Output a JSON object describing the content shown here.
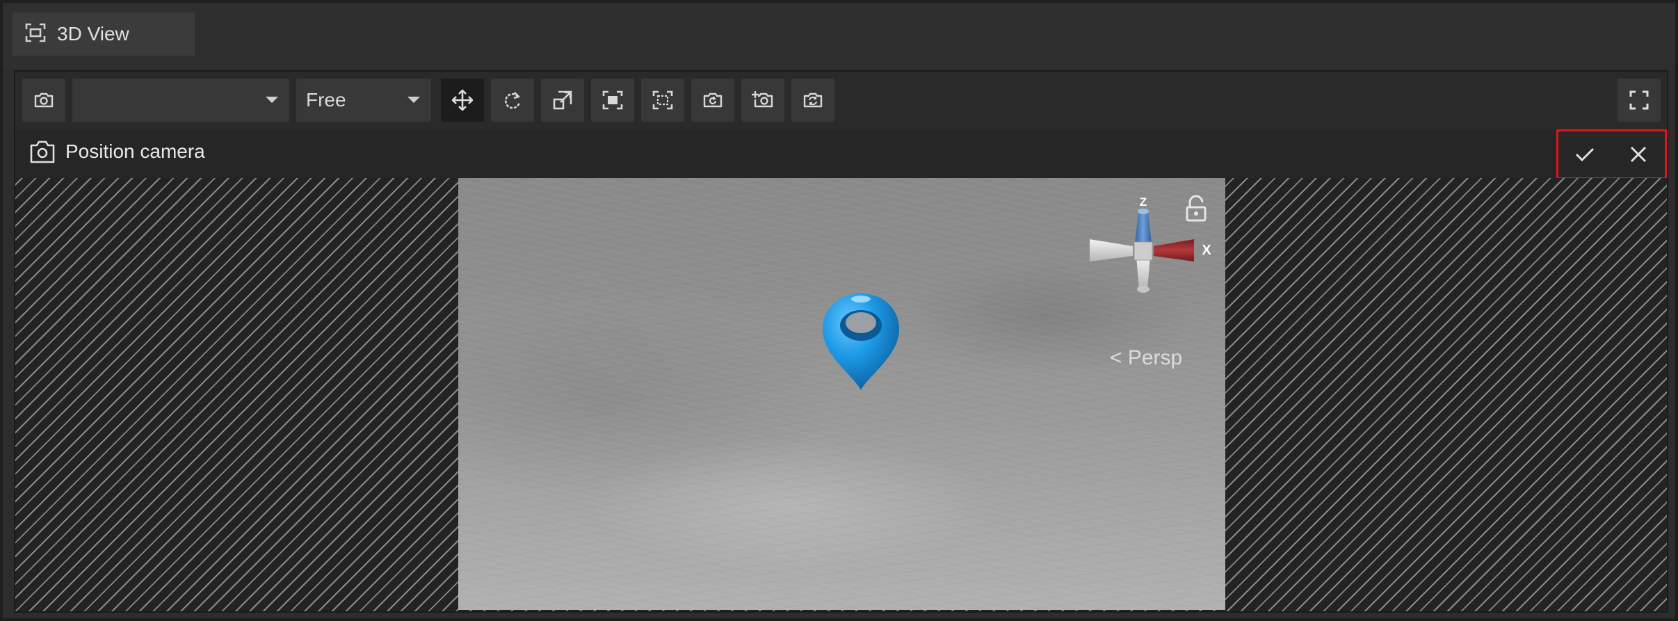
{
  "tab": {
    "title": "3D View",
    "icon": "view-frame-icon"
  },
  "toolbar": {
    "camera_select": {
      "value": "",
      "icon": "chevron-down-icon"
    },
    "navigation_mode": {
      "value": "Free",
      "icon": "chevron-down-icon"
    },
    "tools": [
      {
        "name": "camera-icon"
      },
      {
        "name": "move-icon"
      },
      {
        "name": "rotate-icon"
      },
      {
        "name": "scale-icon"
      },
      {
        "name": "frame-selection-icon"
      },
      {
        "name": "frame-all-icon"
      },
      {
        "name": "reset-camera-icon"
      },
      {
        "name": "add-camera-icon"
      },
      {
        "name": "swap-camera-icon"
      },
      {
        "name": "fullscreen-icon"
      }
    ]
  },
  "mode": {
    "title": "Position camera",
    "icon": "camera-icon",
    "confirm_icon": "check-icon",
    "cancel_icon": "close-icon",
    "highlight_color": "#e0141c"
  },
  "viewport": {
    "projection_label": "< Persp",
    "gizmo": {
      "axis_z": "Z",
      "axis_x": "X",
      "colors": {
        "z": "#4f83c8",
        "x": "#a8272b",
        "neutral": "#d8d8d8"
      }
    },
    "marker_color": "#1e9be8"
  }
}
